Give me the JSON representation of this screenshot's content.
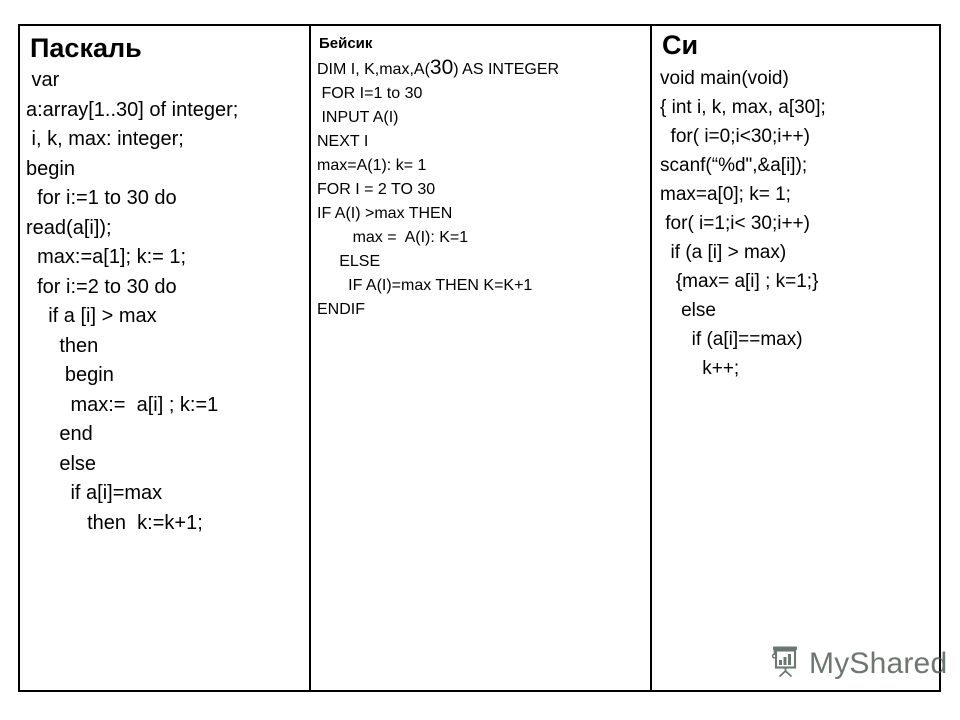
{
  "slide": {
    "table": {
      "columns": [
        {
          "id": "pascal",
          "title": "Паскаль",
          "lines": [
            " var",
            "a:array[1..30] of integer;",
            " i, k, max: integer;",
            "begin",
            "  for i:=1 to 30 do",
            "read(a[i]);",
            "  max:=a[1]; k:= 1;",
            "  for i:=2 to 30 do",
            "    if a [i] > max",
            "      then",
            "       begin",
            "        max:=  a[i] ; k:=1",
            "      end",
            "      else",
            "        if a[i]=max",
            "           then  k:=k+1;"
          ]
        },
        {
          "id": "basic",
          "title": "Бейсик",
          "lines": [
            "DIM I, K,max,A(30) AS INTEGER",
            " FOR I=1 to 30",
            " INPUT A(I)",
            "NEXT I",
            "max=A(1): k= 1",
            "FOR I = 2 TO 30",
            "IF A(I) >max THEN",
            "        max =  A(I): K=1",
            "     ELSE",
            "       IF A(I)=max THEN K=K+1",
            "ENDIF"
          ]
        },
        {
          "id": "c",
          "title": "Си",
          "lines": [
            "void main(void)",
            "{ int i, k, max, a[30];",
            "  for( i=0;i<30;i++)",
            "scanf(“%d\",&a[i]);",
            "max=a[0]; k= 1;",
            " for( i=1;i< 30;i++)",
            "  if (a [i] > max)",
            "   {max= a[i] ; k=1;}",
            "    else",
            "      if (a[i]==max)",
            "        k++;"
          ]
        }
      ]
    },
    "watermark": {
      "text": "MyShared",
      "icon": "presentation-board-icon",
      "color": "#4c5a52"
    }
  }
}
